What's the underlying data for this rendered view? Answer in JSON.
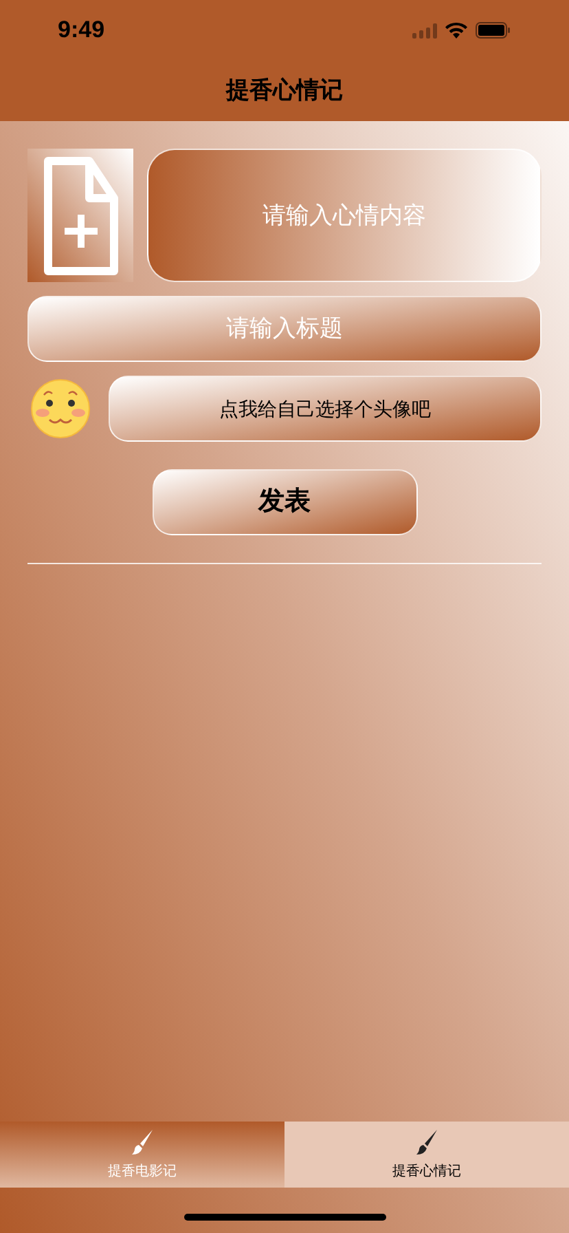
{
  "status_bar": {
    "time": "9:49"
  },
  "nav": {
    "title": "提香心情记"
  },
  "form": {
    "content_placeholder": "请输入心情内容",
    "title_placeholder": "请输入标题",
    "avatar_button": "点我给自己选择个头像吧",
    "submit_button": "发表"
  },
  "tabs": [
    {
      "label": "提香电影记",
      "selected": false
    },
    {
      "label": "提香心情记",
      "selected": true
    }
  ]
}
